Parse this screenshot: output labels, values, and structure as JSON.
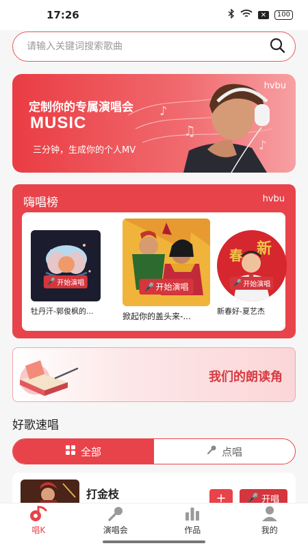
{
  "status_bar": {
    "time": "17:26",
    "battery": "100"
  },
  "search": {
    "placeholder": "请输入关键词搜索歌曲"
  },
  "banner": {
    "title": "定制你的专属演唱会",
    "music": "MUSIC",
    "subtitle": "三分钟，生成你的个人MV",
    "brand": "hvbu"
  },
  "chart": {
    "title": "嗨唱榜",
    "brand": "hvbu",
    "songs": [
      {
        "name": "牡丹汗-郭俊枫的...",
        "tag": "开始演唱"
      },
      {
        "name": "掀起你的盖头来-...",
        "tag": "开始演唱"
      },
      {
        "name": "新春好-夏艺杰",
        "tag": "开始演唱"
      }
    ]
  },
  "reading": {
    "label": "我们的朗读角"
  },
  "quick_sing": {
    "heading": "好歌速唱",
    "tabs": [
      {
        "label": "全部",
        "icon": "grid-icon"
      },
      {
        "label": "点唱",
        "icon": "microphone-icon"
      }
    ]
  },
  "song_row": {
    "title": "打金枝",
    "add_label": "+",
    "sing_label": "开唱"
  },
  "tabbar": {
    "items": [
      {
        "label": "唱K",
        "icon": "music-note-icon"
      },
      {
        "label": "演唱会",
        "icon": "microphone-icon"
      },
      {
        "label": "作品",
        "icon": "bar-chart-icon"
      },
      {
        "label": "我的",
        "icon": "user-icon"
      }
    ]
  },
  "colors": {
    "accent": "#e8434a",
    "accent_dark": "#d5353c"
  }
}
